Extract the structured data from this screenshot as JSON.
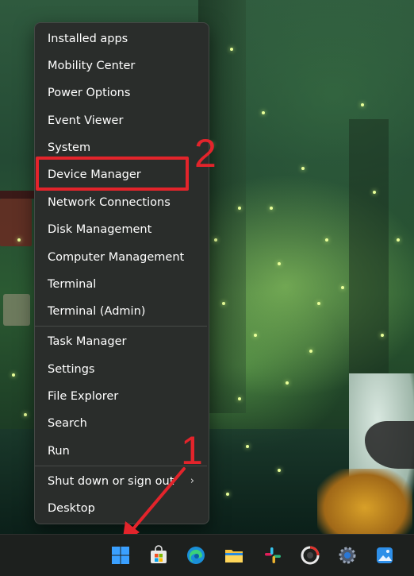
{
  "context_menu": {
    "items": [
      {
        "label": "Installed apps"
      },
      {
        "label": "Mobility Center"
      },
      {
        "label": "Power Options"
      },
      {
        "label": "Event Viewer"
      },
      {
        "label": "System"
      },
      {
        "label": "Device Manager"
      },
      {
        "label": "Network Connections"
      },
      {
        "label": "Disk Management"
      },
      {
        "label": "Computer Management"
      },
      {
        "label": "Terminal"
      },
      {
        "label": "Terminal (Admin)"
      },
      {
        "label": "Task Manager"
      },
      {
        "label": "Settings"
      },
      {
        "label": "File Explorer"
      },
      {
        "label": "Search"
      },
      {
        "label": "Run"
      },
      {
        "label": "Shut down or sign out",
        "has_submenu": true
      },
      {
        "label": "Desktop"
      }
    ]
  },
  "annotations": {
    "step1": "1",
    "step2": "2",
    "color": "#e3242b"
  },
  "taskbar": {
    "icons": [
      "windows-start-icon",
      "microsoft-store-icon",
      "edge-browser-icon",
      "file-explorer-icon",
      "slack-icon",
      "recorder-app-icon",
      "settings-gear-icon",
      "photos-icon"
    ]
  }
}
